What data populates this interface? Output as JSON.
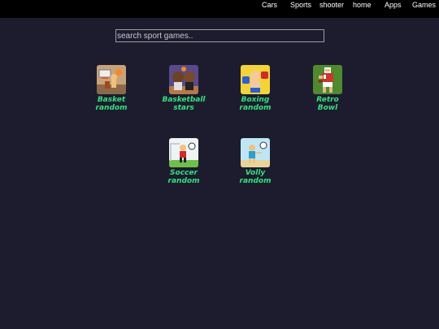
{
  "nav": {
    "items": [
      "Cars",
      "Sports",
      "shooter",
      "home",
      "Apps",
      "Games"
    ]
  },
  "search": {
    "placeholder": "search sport games..",
    "value": ""
  },
  "games": [
    {
      "line1": "Basket",
      "line2": "random",
      "icon": "basket-random-icon"
    },
    {
      "line1": "Basketball",
      "line2": "stars",
      "icon": "basketball-stars-icon"
    },
    {
      "line1": "Boxing",
      "line2": "random",
      "icon": "boxing-random-icon"
    },
    {
      "line1": "Retro",
      "line2": "Bowl",
      "icon": "retro-bowl-icon"
    },
    {
      "line1": "Soccer",
      "line2": "random",
      "icon": "soccer-random-icon"
    },
    {
      "line1": "Volly",
      "line2": "random",
      "icon": "volly-random-icon"
    }
  ],
  "colors": {
    "background": "#1d1c2e",
    "topbar": "#000000",
    "label": "#35e07e"
  }
}
